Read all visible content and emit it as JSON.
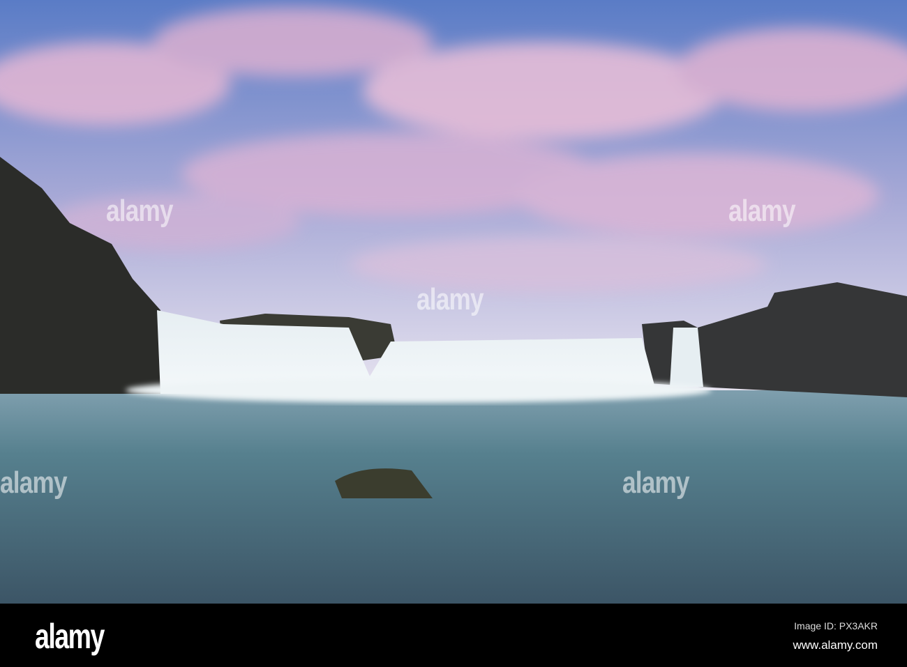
{
  "photo": {
    "subject": "waterfall",
    "colors": {
      "sky_blue": "#5b7fc4",
      "cloud_pink": "#e2b6d3",
      "water": "#4d6e7c",
      "rock": "#2a2a28"
    }
  },
  "watermark": {
    "text": "alamy"
  },
  "footer": {
    "logo": "alamy",
    "image_id": "Image ID: PX3AKR",
    "url": "www.alamy.com"
  }
}
